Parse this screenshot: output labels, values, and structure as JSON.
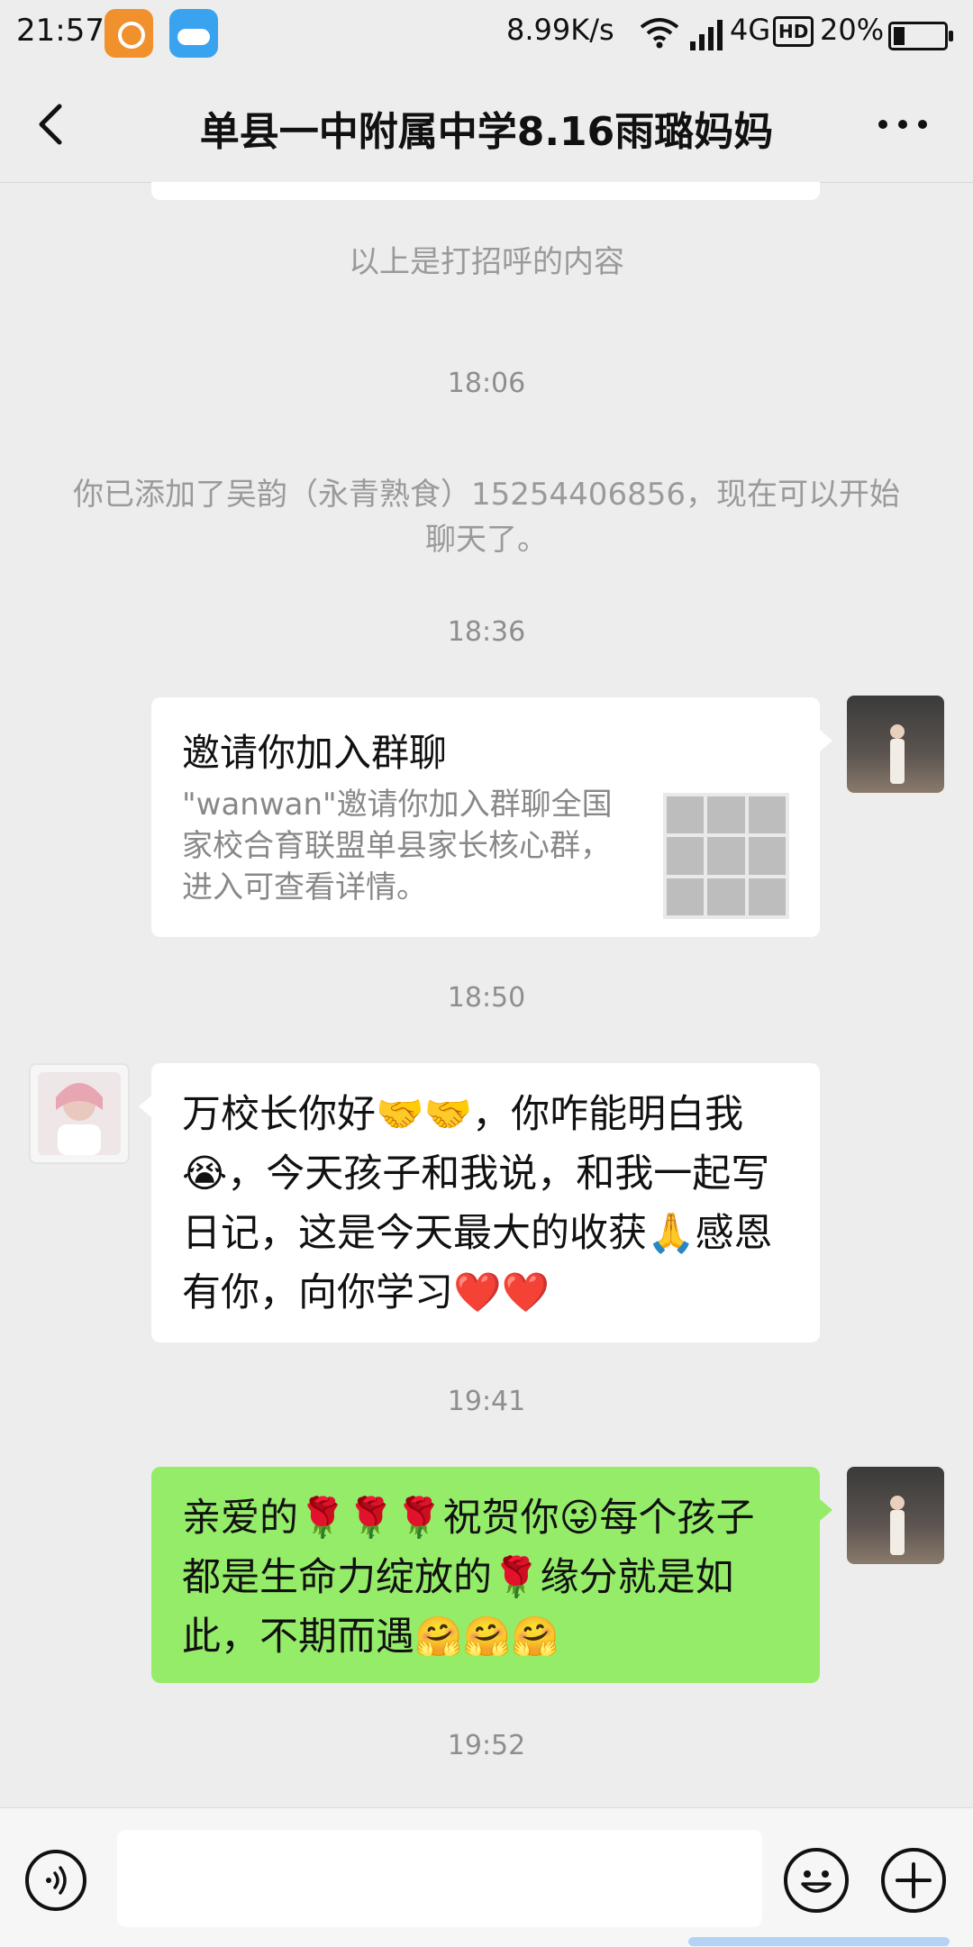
{
  "status_bar": {
    "time": "21:57",
    "speed": "8.99K/s",
    "network": "4G",
    "hd": "HD",
    "battery": "20%"
  },
  "nav": {
    "title": "单县一中附属中学8.16雨璐妈妈"
  },
  "messages": {
    "greeting_note": "以上是打招呼的内容",
    "time_1": "18:06",
    "added_note": "你已添加了吴韵（永青熟食）15254406856，现在可以开始聊天了。",
    "time_2": "18:36",
    "invite_card": {
      "title": "邀请你加入群聊",
      "description": "\"wanwan\"邀请你加入群聊全国家校合育联盟单县家长核心群，进入可查看详情。"
    },
    "time_3": "18:50",
    "received_text": "万校长你好🤝🤝，你咋能明白我😭，今天孩子和我说，和我一起写日记，这是今天最大的收获🙏感恩有你，向你学习❤️❤️",
    "time_4": "19:41",
    "sent_text": "亲爱的🌹🌹🌹祝贺你😜每个孩子都是生命力绽放的🌹缘分就是如此，不期而遇🤗🤗🤗",
    "time_5": "19:52"
  },
  "input_bar": {
    "placeholder": ""
  },
  "colors": {
    "background": "#ededed",
    "sent_bubble": "#95ec69",
    "received_bubble": "#ffffff"
  }
}
